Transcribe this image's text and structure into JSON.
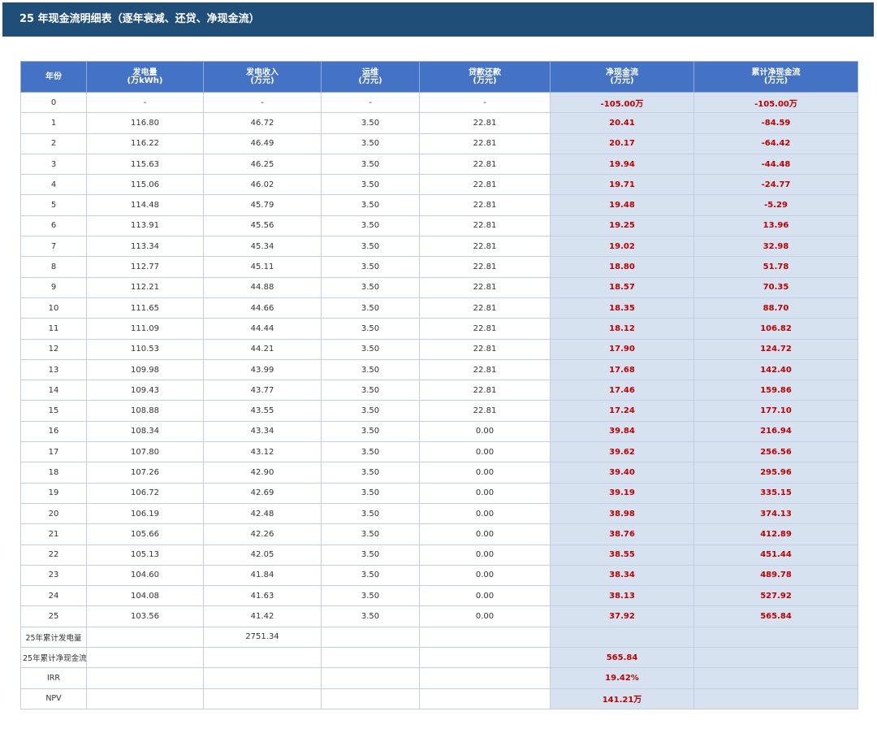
{
  "title": "25 年现金流明细表（逐年衰减、还贷、净现金流）",
  "headers": [
    {
      "line1": "年份",
      "line2": ""
    },
    {
      "line1": "发电量",
      "line2": "(万kWh)"
    },
    {
      "line1": "发电收入",
      "line2": "(万元)"
    },
    {
      "line1": "运维",
      "line2": "(万元)"
    },
    {
      "line1": "贷款还款",
      "line2": "(万元)"
    },
    {
      "line1": "净现金流",
      "line2": "(万元)"
    },
    {
      "line1": "累计净现金流",
      "line2": "(万元)"
    }
  ],
  "rows": [
    [
      "0",
      "-",
      "-",
      "-",
      "-",
      "-105.00万",
      "-105.00万"
    ],
    [
      "1",
      "116.80",
      "46.72",
      "3.50",
      "22.81",
      "20.41",
      "-84.59"
    ],
    [
      "2",
      "116.22",
      "46.49",
      "3.50",
      "22.81",
      "20.17",
      "-64.42"
    ],
    [
      "3",
      "115.63",
      "46.25",
      "3.50",
      "22.81",
      "19.94",
      "-44.48"
    ],
    [
      "4",
      "115.06",
      "46.02",
      "3.50",
      "22.81",
      "19.71",
      "-24.77"
    ],
    [
      "5",
      "114.48",
      "45.79",
      "3.50",
      "22.81",
      "19.48",
      "-5.29"
    ],
    [
      "6",
      "113.91",
      "45.56",
      "3.50",
      "22.81",
      "19.25",
      "13.96"
    ],
    [
      "7",
      "113.34",
      "45.34",
      "3.50",
      "22.81",
      "19.02",
      "32.98"
    ],
    [
      "8",
      "112.77",
      "45.11",
      "3.50",
      "22.81",
      "18.80",
      "51.78"
    ],
    [
      "9",
      "112.21",
      "44.88",
      "3.50",
      "22.81",
      "18.57",
      "70.35"
    ],
    [
      "10",
      "111.65",
      "44.66",
      "3.50",
      "22.81",
      "18.35",
      "88.70"
    ],
    [
      "11",
      "111.09",
      "44.44",
      "3.50",
      "22.81",
      "18.12",
      "106.82"
    ],
    [
      "12",
      "110.53",
      "44.21",
      "3.50",
      "22.81",
      "17.90",
      "124.72"
    ],
    [
      "13",
      "109.98",
      "43.99",
      "3.50",
      "22.81",
      "17.68",
      "142.40"
    ],
    [
      "14",
      "109.43",
      "43.77",
      "3.50",
      "22.81",
      "17.46",
      "159.86"
    ],
    [
      "15",
      "108.88",
      "43.55",
      "3.50",
      "22.81",
      "17.24",
      "177.10"
    ],
    [
      "16",
      "108.34",
      "43.34",
      "3.50",
      "0.00",
      "39.84",
      "216.94"
    ],
    [
      "17",
      "107.80",
      "43.12",
      "3.50",
      "0.00",
      "39.62",
      "256.56"
    ],
    [
      "18",
      "107.26",
      "42.90",
      "3.50",
      "0.00",
      "39.40",
      "295.96"
    ],
    [
      "19",
      "106.72",
      "42.69",
      "3.50",
      "0.00",
      "39.19",
      "335.15"
    ],
    [
      "20",
      "106.19",
      "42.48",
      "3.50",
      "0.00",
      "38.98",
      "374.13"
    ],
    [
      "21",
      "105.66",
      "42.26",
      "3.50",
      "0.00",
      "38.76",
      "412.89"
    ],
    [
      "22",
      "105.13",
      "42.05",
      "3.50",
      "0.00",
      "38.55",
      "451.44"
    ],
    [
      "23",
      "104.60",
      "41.84",
      "3.50",
      "0.00",
      "38.34",
      "489.78"
    ],
    [
      "24",
      "104.08",
      "41.63",
      "3.50",
      "0.00",
      "38.13",
      "527.92"
    ],
    [
      "25",
      "103.56",
      "41.42",
      "3.50",
      "0.00",
      "37.92",
      "565.84"
    ]
  ],
  "summary": [
    {
      "label": "25年累计发电量",
      "revenue": "2751.34",
      "net": ""
    },
    {
      "label": "25年累计净现金流",
      "revenue": "",
      "net": "565.84"
    },
    {
      "label": "IRR",
      "revenue": "",
      "net": "19.42%"
    },
    {
      "label": "NPV",
      "revenue": "",
      "net": "141.21万"
    }
  ],
  "colors": {
    "title_bg": "#1f4e79",
    "header_bg": "#4472c4",
    "highlight_bg": "#d6e2f0",
    "highlight_text": "#c00000"
  }
}
